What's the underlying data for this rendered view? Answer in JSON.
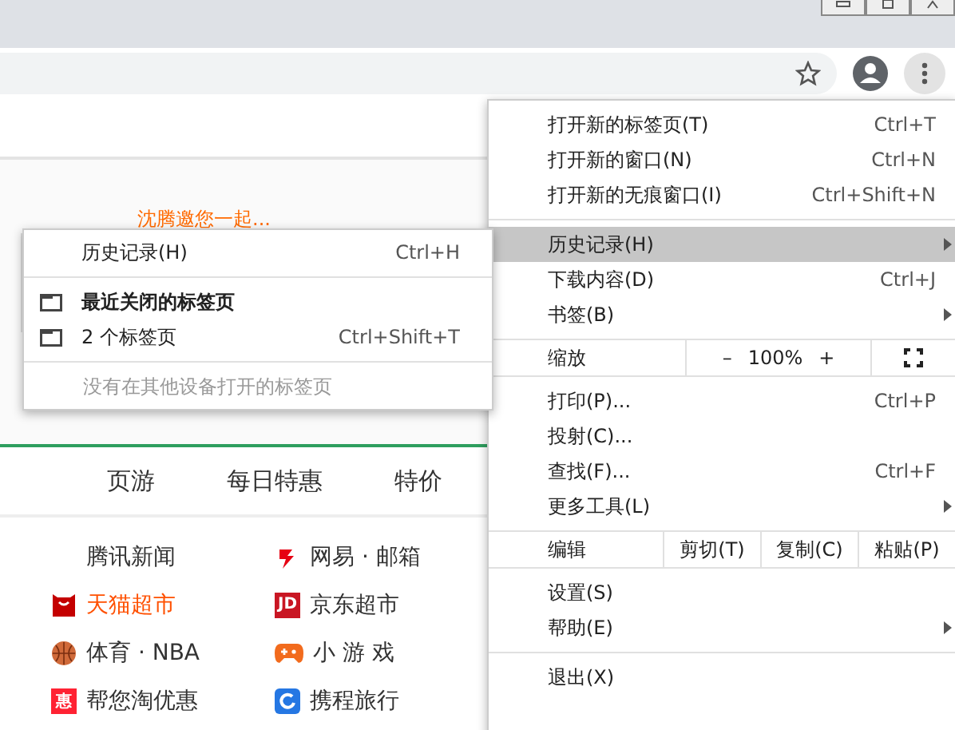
{
  "toolbar": {
    "bookmarked": false
  },
  "page": {
    "promo": "沈腾邀您一起...",
    "nav_tabs": [
      "页游",
      "每日特惠",
      "特价"
    ],
    "links": [
      {
        "label": "腾讯新闻",
        "kind": "plain",
        "highlight": false
      },
      {
        "label": "网易 · 邮箱",
        "kind": "netease",
        "highlight": false
      },
      {
        "label": "天猫超市",
        "kind": "tmall",
        "highlight": true
      },
      {
        "label": "京东超市",
        "kind": "jd",
        "badge": "JD",
        "highlight": false
      },
      {
        "label": "体育 · NBA",
        "kind": "ball",
        "highlight": false
      },
      {
        "label": "小 游 戏",
        "kind": "gamepad",
        "highlight": false
      },
      {
        "label": "帮您淘优惠",
        "kind": "hui",
        "badge": "惠",
        "highlight": false
      },
      {
        "label": "携程旅行",
        "kind": "ctrip",
        "highlight": false
      }
    ]
  },
  "menu": {
    "sections": [
      [
        {
          "label": "打开新的标签页(T)",
          "shortcut": "Ctrl+T",
          "submenu": false,
          "selected": false
        },
        {
          "label": "打开新的窗口(N)",
          "shortcut": "Ctrl+N",
          "submenu": false,
          "selected": false
        },
        {
          "label": "打开新的无痕窗口(I)",
          "shortcut": "Ctrl+Shift+N",
          "submenu": false,
          "selected": false
        }
      ],
      [
        {
          "label": "历史记录(H)",
          "submenu": true,
          "selected": true
        },
        {
          "label": "下载内容(D)",
          "shortcut": "Ctrl+J",
          "submenu": false,
          "selected": false
        },
        {
          "label": "书签(B)",
          "submenu": true,
          "selected": false
        }
      ]
    ],
    "zoom": {
      "label": "缩放",
      "minus": "–",
      "value": "100%",
      "plus": "+"
    },
    "sections2": [
      [
        {
          "label": "打印(P)...",
          "shortcut": "Ctrl+P",
          "submenu": false,
          "selected": false
        },
        {
          "label": "投射(C)...",
          "submenu": false,
          "selected": false
        },
        {
          "label": "查找(F)...",
          "shortcut": "Ctrl+F",
          "submenu": false,
          "selected": false
        },
        {
          "label": "更多工具(L)",
          "submenu": true,
          "selected": false
        }
      ]
    ],
    "edit": {
      "label": "编辑",
      "buttons": [
        "剪切(T)",
        "复制(C)",
        "粘贴(P)"
      ]
    },
    "sections3": [
      [
        {
          "label": "设置(S)",
          "submenu": false,
          "selected": false
        },
        {
          "label": "帮助(E)",
          "submenu": true,
          "selected": false
        }
      ],
      [
        {
          "label": "退出(X)",
          "submenu": false,
          "selected": false
        }
      ]
    ]
  },
  "history_submenu": {
    "title": "历史记录(H)",
    "shortcut": "Ctrl+H",
    "items": [
      {
        "label": "最近关闭的标签页",
        "bold": true
      },
      {
        "label": "2 个标签页",
        "shortcut": "Ctrl+Shift+T",
        "bold": false
      }
    ],
    "note": "没有在其他设备打开的标签页"
  }
}
